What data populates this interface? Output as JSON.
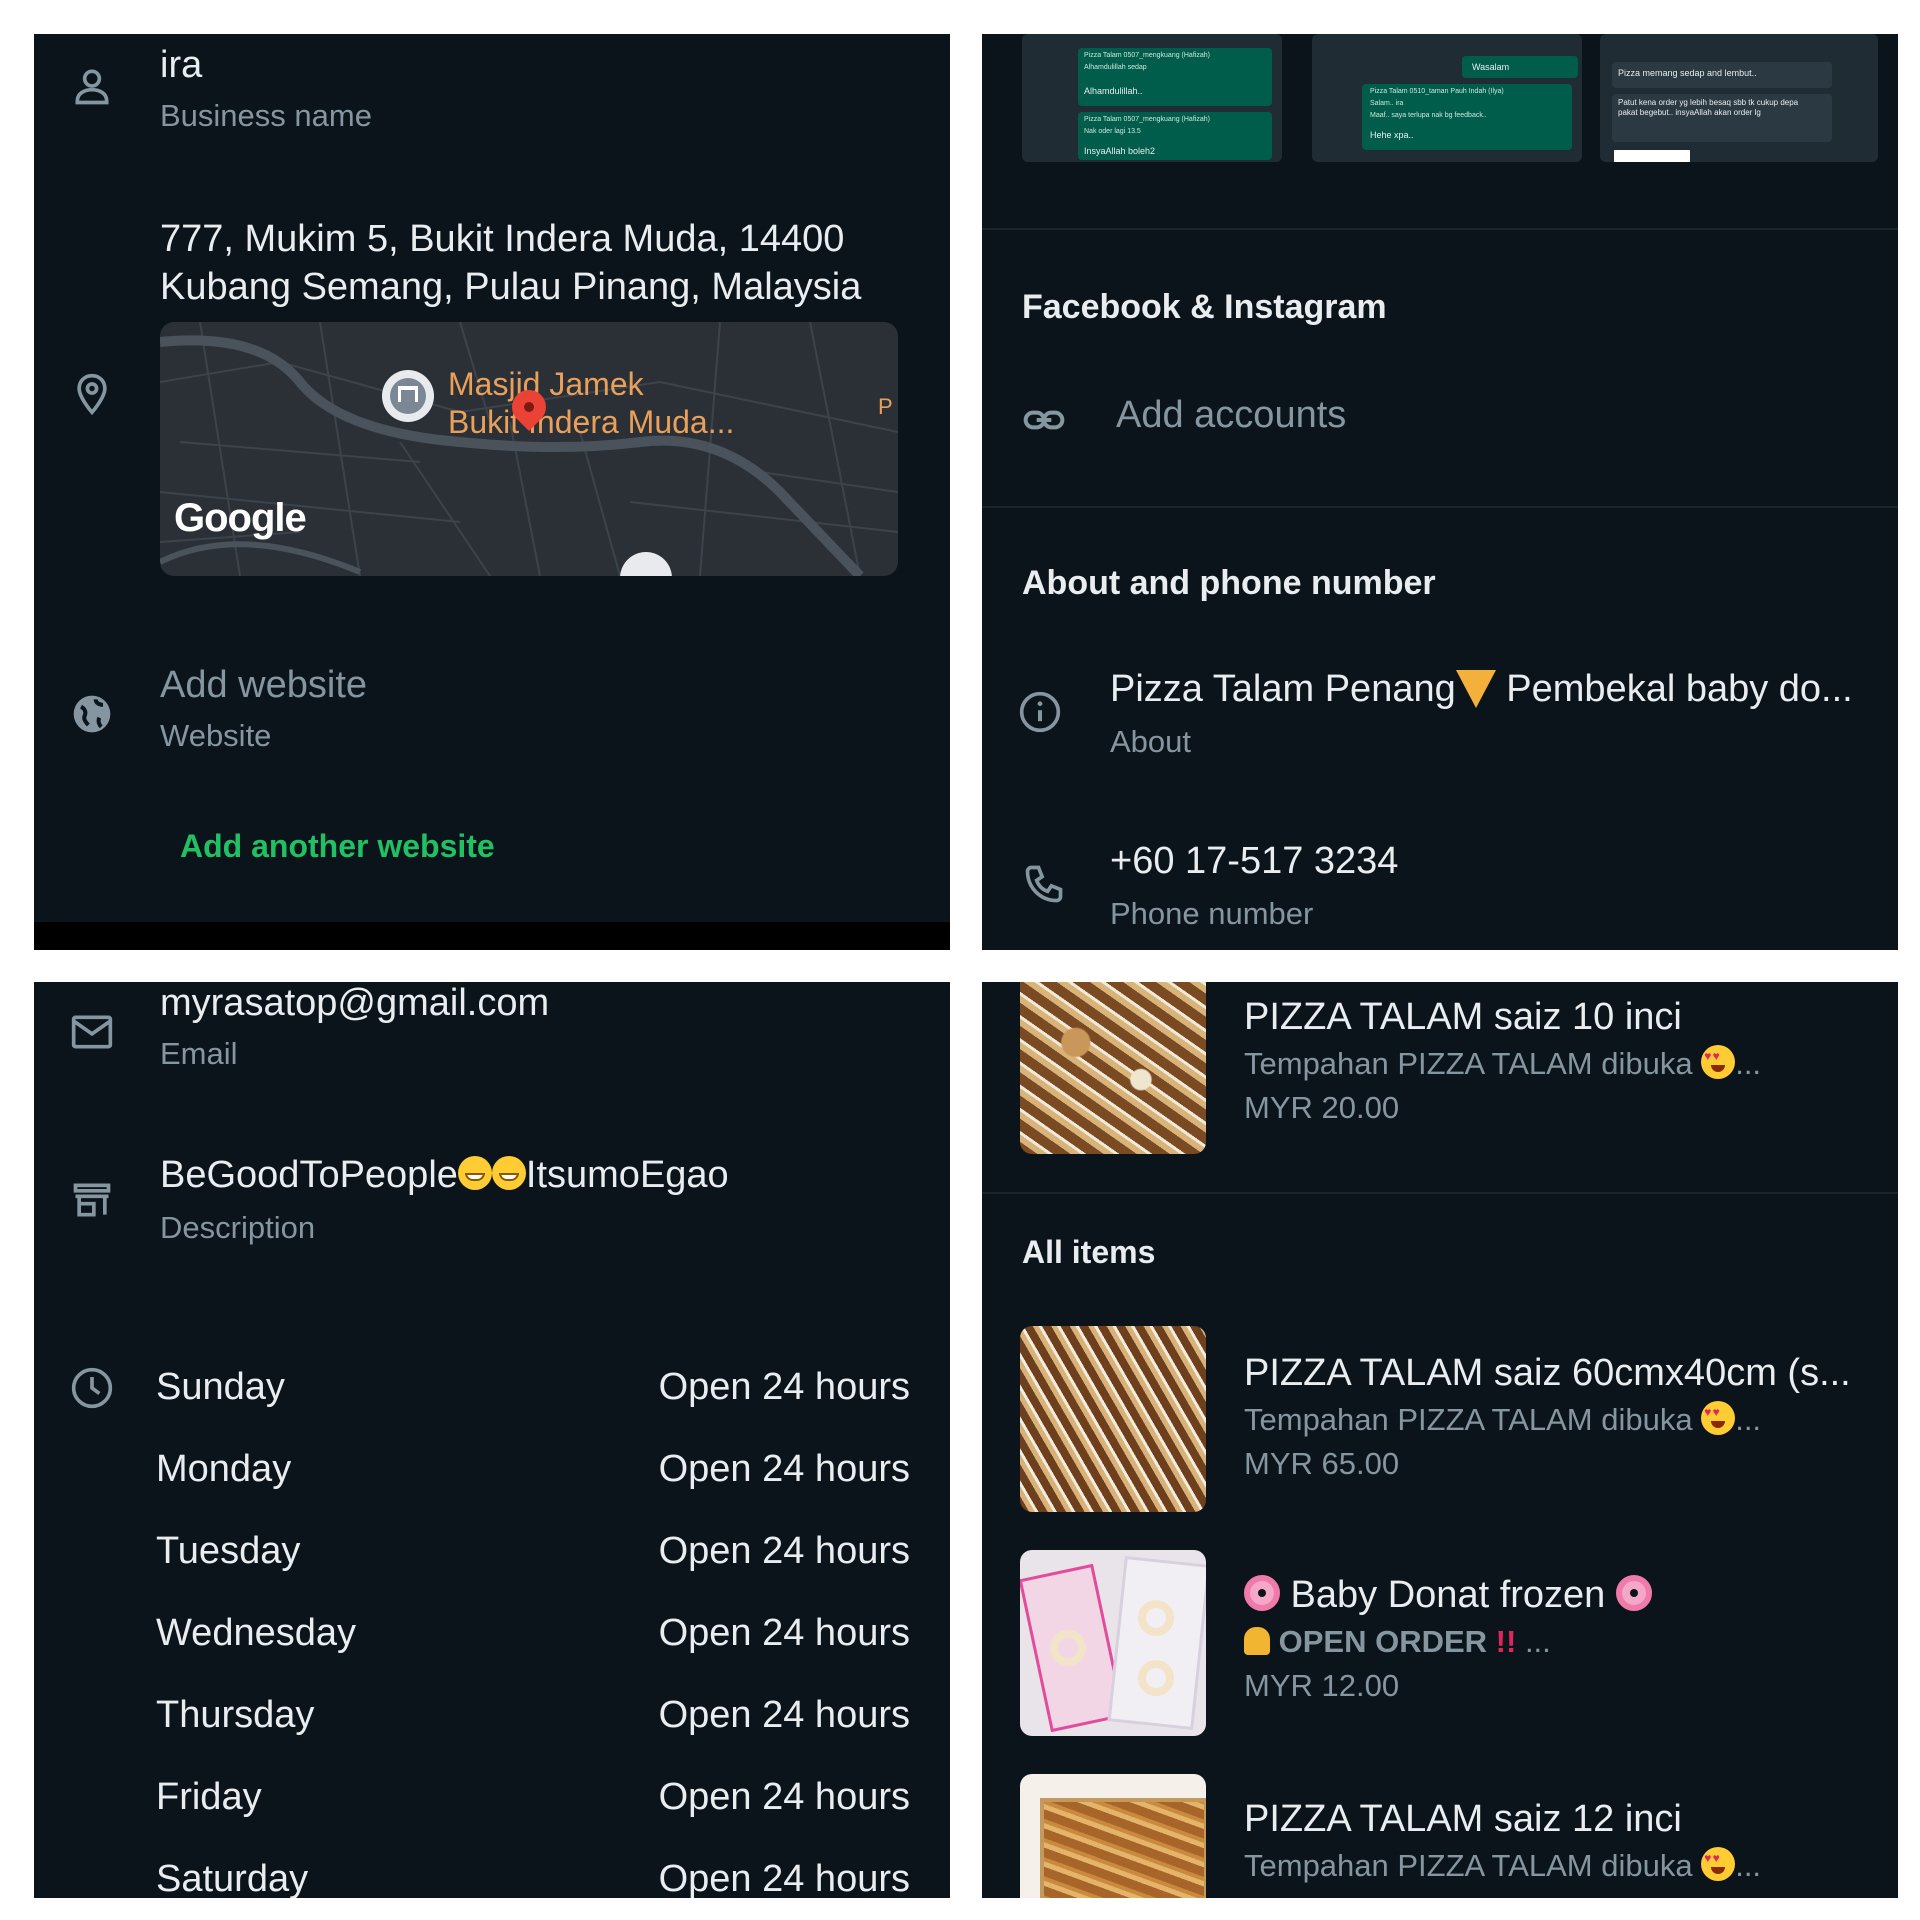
{
  "profile": {
    "business_name_value": "ira",
    "business_name_label": "Business name",
    "address_line1": "777, Mukim 5, Bukit Indera Muda, 14400",
    "address_line2": "Kubang Semang, Pulau Pinang, Malaysia",
    "map": {
      "place_line1": "Masjid Jamek",
      "place_line2": "Bukit Indera Muda...",
      "edge_label": "P",
      "watermark": "Google"
    },
    "website_value": "Add website",
    "website_label": "Website",
    "add_another_website": "Add another website",
    "email_value": "myrasatop@gmail.com",
    "email_label": "Email",
    "description_value_part1": "BeGoodToPeople",
    "description_value_part2": "ItsumoEgao",
    "description_label": "Description"
  },
  "hours": [
    {
      "day": "Sunday",
      "hours": "Open 24 hours"
    },
    {
      "day": "Monday",
      "hours": "Open 24 hours"
    },
    {
      "day": "Tuesday",
      "hours": "Open 24 hours"
    },
    {
      "day": "Wednesday",
      "hours": "Open 24 hours"
    },
    {
      "day": "Thursday",
      "hours": "Open 24 hours"
    },
    {
      "day": "Friday",
      "hours": "Open 24 hours"
    },
    {
      "day": "Saturday",
      "hours": "Open 24 hours"
    }
  ],
  "social": {
    "heading": "Facebook & Instagram",
    "add_accounts": "Add accounts"
  },
  "about_section": {
    "heading": "About and phone number",
    "about_value_part1": "Pizza Talam Penang",
    "about_value_part2": " Pembekal baby do...",
    "about_label": "About",
    "phone_value": "+60 17-517 3234",
    "phone_label": "Phone number"
  },
  "chat_preview": {
    "lines": [
      "Pizza Talam 0507_mengkuang (Hafizah)",
      "Alhamdulillah sedap",
      "Alhamdulillah..",
      "Pizza Talam 0507_mengkuang (Hafizah)",
      "Nak oder lagi 13.5",
      "InsyaAllah boleh2",
      "Wasalam",
      "Pizza Talam 0510_taman Pauh Indah (Ilya)",
      "Salam.. ira",
      "Maaf.. saya terlupa nak bg feedback..",
      "Hehe xpa..",
      "Pizza memang sedap and lembut..",
      "Patut kena order yg lebih besaq sbb tk cukup depa pakat begebut.. insyaAllah akan order lg"
    ]
  },
  "catalog": {
    "all_items_heading": "All items",
    "items": [
      {
        "title": "PIZZA TALAM saiz 10 inci",
        "desc": "Tempahan PIZZA TALAM dibuka",
        "price": "MYR 20.00"
      },
      {
        "title": "PIZZA TALAM saiz 60cmx40cm (s...",
        "desc": "Tempahan PIZZA TALAM dibuka",
        "price": "MYR 65.00"
      },
      {
        "title_part": " Baby Donat frozen ",
        "desc_part": " OPEN ORDER ",
        "price": "MYR 12.00"
      },
      {
        "title": "PIZZA TALAM saiz 12 inci",
        "desc": "Tempahan PIZZA TALAM dibuka"
      }
    ],
    "ellipsis": "..."
  },
  "colors": {
    "background": "#0b141a",
    "primary_text": "#e9edef",
    "secondary_text": "#8696a0",
    "accent_green": "#21c063"
  }
}
